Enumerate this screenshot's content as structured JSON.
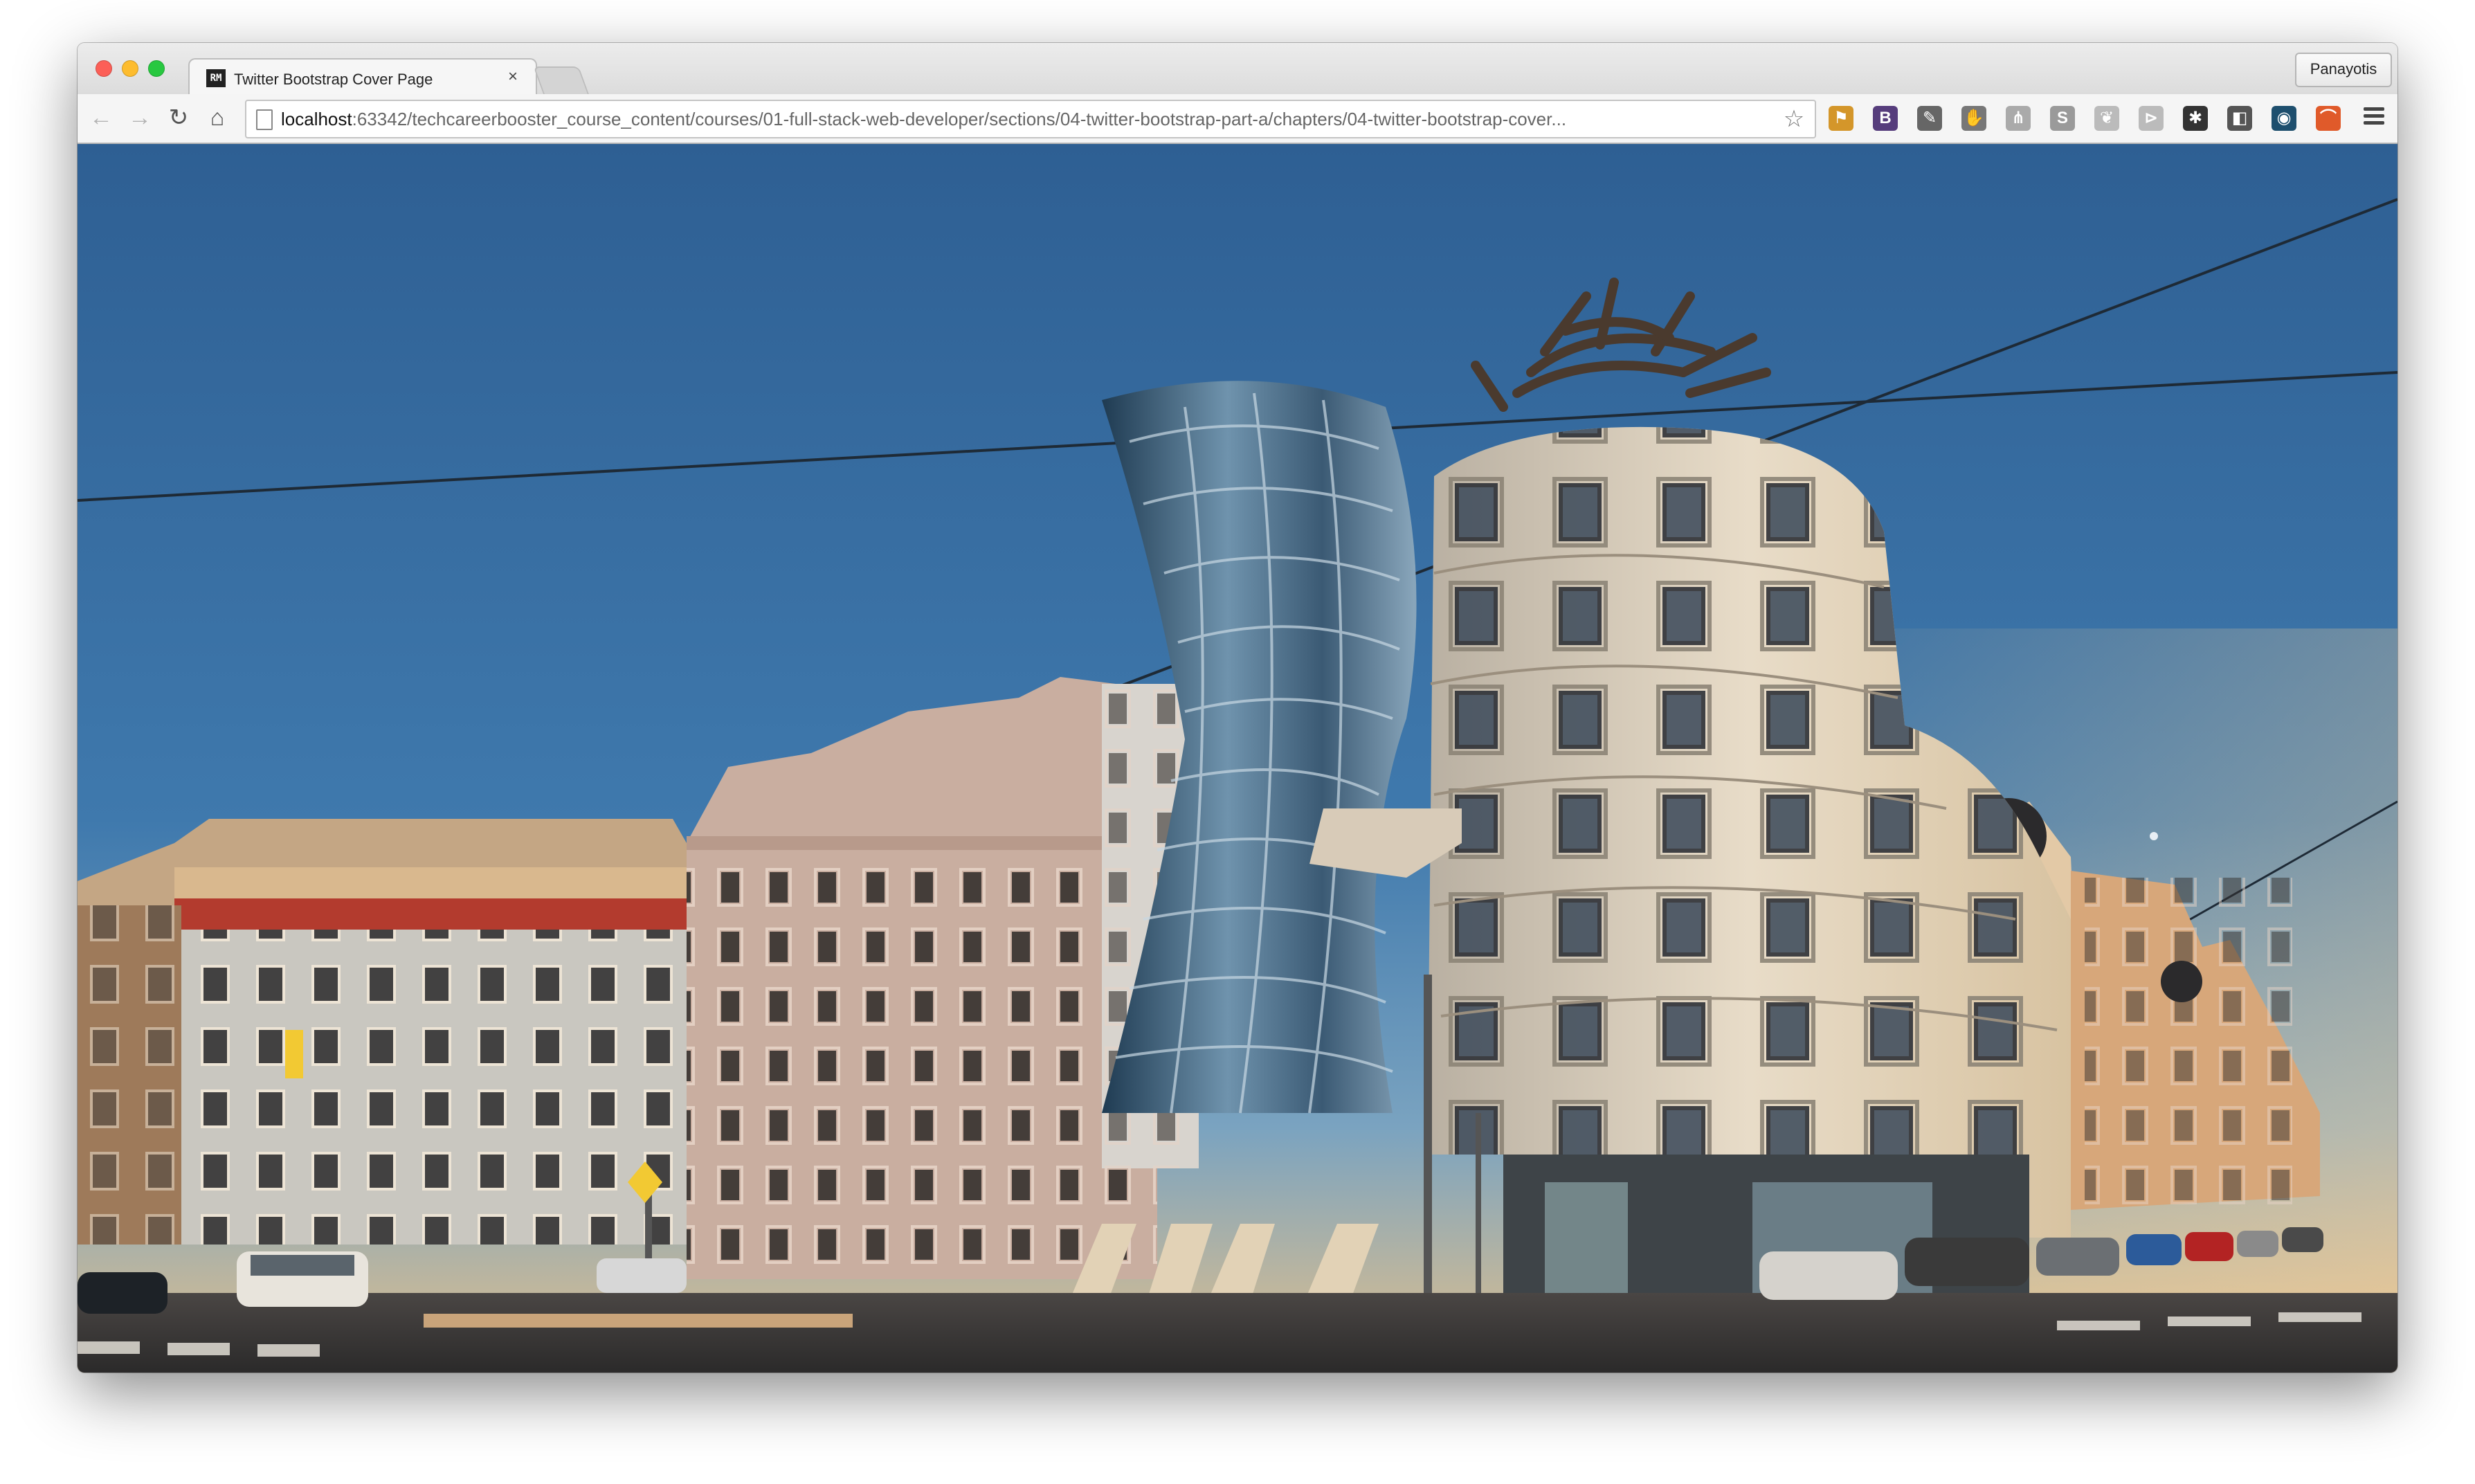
{
  "window": {
    "tab": {
      "title": "Twitter Bootstrap Cover Page",
      "favicon_text": "RM",
      "close_symbol": "×"
    },
    "profile_name": "Panayotis"
  },
  "toolbar": {
    "back_icon": "←",
    "forward_icon": "→",
    "reload_icon": "↻",
    "home_icon": "⌂",
    "url_host": "localhost",
    "url_rest": ":63342/techcareerbooster_course_content/courses/01-full-stack-web-developer/sections/04-twitter-bootstrap-part-a/chapters/04-twitter-bootstrap-cover...",
    "bookmark_icon": "☆",
    "extensions": [
      {
        "name": "bookmark-flag-extension",
        "glyph": "⚑",
        "color": "#d4962a"
      },
      {
        "name": "bootstrap-extension",
        "glyph": "B",
        "color": "#563d7c"
      },
      {
        "name": "eyedropper-extension",
        "glyph": "✎",
        "color": "#666666"
      },
      {
        "name": "hand-extension",
        "glyph": "✋",
        "color": "#777777"
      },
      {
        "name": "sitemap-extension",
        "glyph": "⋔",
        "color": "#aaaaaa"
      },
      {
        "name": "skype-extension",
        "glyph": "S",
        "color": "#9a9a9a"
      },
      {
        "name": "leaf-extension",
        "glyph": "❦",
        "color": "#bbbbbb"
      },
      {
        "name": "fan-extension",
        "glyph": "⊳",
        "color": "#bbbbbb"
      },
      {
        "name": "aperture-extension",
        "glyph": "✱",
        "color": "#333333"
      },
      {
        "name": "screenshot-extension",
        "glyph": "◧",
        "color": "#555555"
      },
      {
        "name": "lock-extension",
        "glyph": "◉",
        "color": "#1e4f6e"
      },
      {
        "name": "rainbow-extension",
        "glyph": "⌒",
        "color": "#e05a2a"
      }
    ]
  },
  "page": {
    "image_description_name": "dancing-house-photo"
  }
}
